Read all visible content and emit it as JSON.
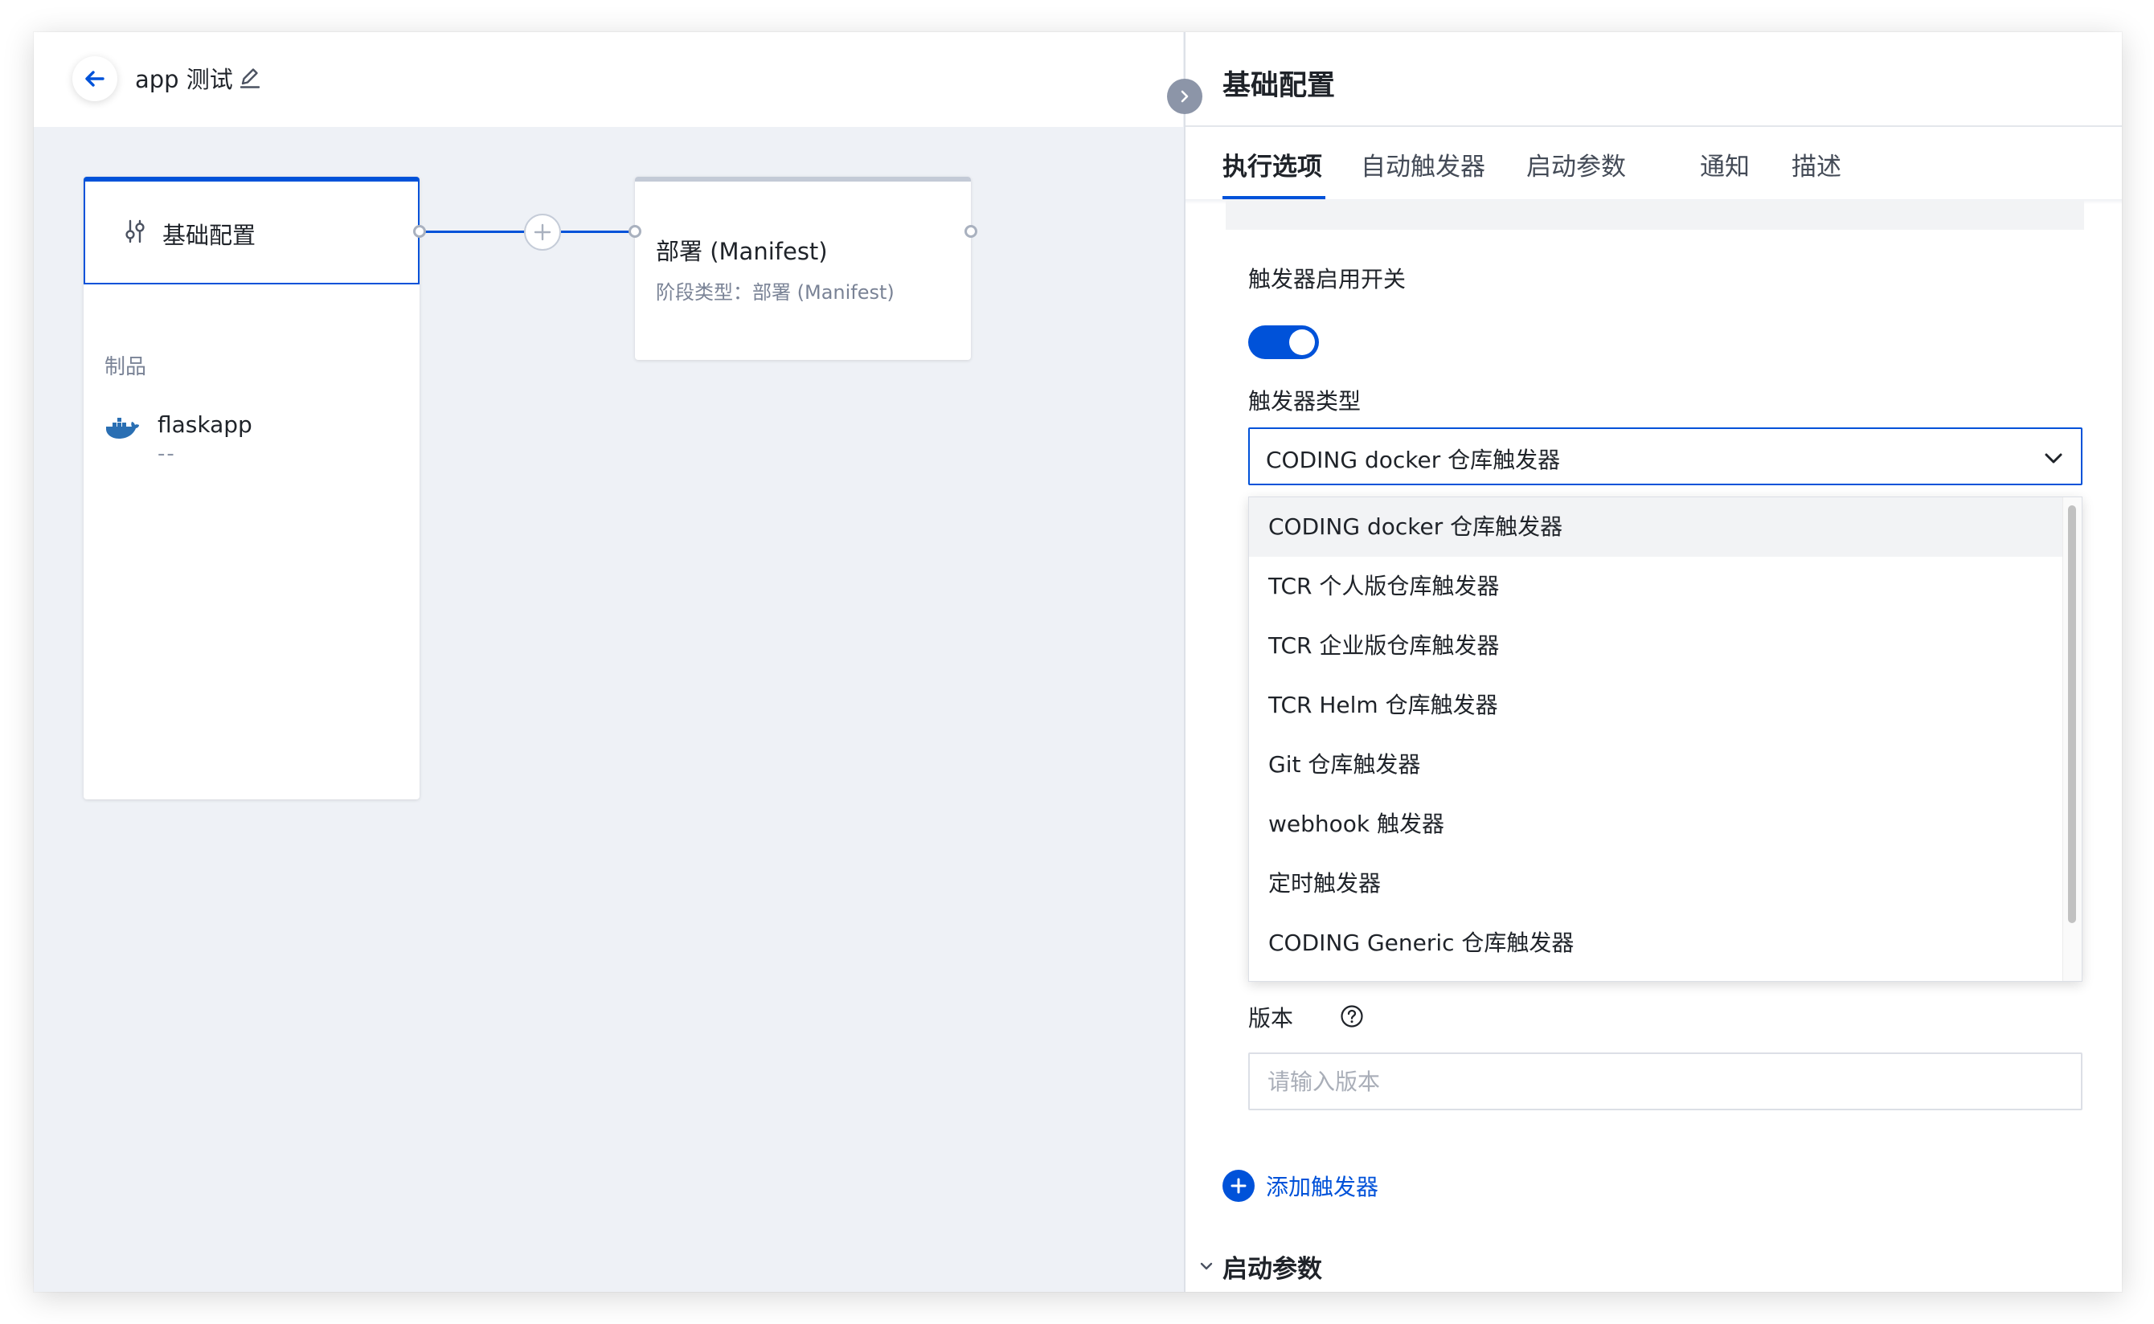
{
  "header": {
    "app_name": "app 测试"
  },
  "pipeline": {
    "base_stage": {
      "name": "基础配置",
      "section_label": "制品",
      "artifact_name": "flaskapp",
      "artifact_version": "--"
    },
    "deploy_stage": {
      "name": "部署 (Manifest)",
      "subtitle": "阶段类型：部署 (Manifest)"
    }
  },
  "panel": {
    "title": "基础配置",
    "tabs": [
      {
        "label": "执行选项"
      },
      {
        "label": "自动触发器"
      },
      {
        "label": "启动参数"
      },
      {
        "label": "通知"
      },
      {
        "label": "描述"
      }
    ],
    "trigger_switch_label": "触发器启用开关",
    "trigger_enabled": true,
    "trigger_type_label": "触发器类型",
    "trigger_type_value": "CODING docker 仓库触发器",
    "trigger_type_options": [
      "CODING docker 仓库触发器",
      "TCR 个人版仓库触发器",
      "TCR 企业版仓库触发器",
      "TCR Helm 仓库触发器",
      "Git 仓库触发器",
      "webhook 触发器",
      "定时触发器",
      "CODING Generic 仓库触发器"
    ],
    "version_label": "版本",
    "version_placeholder": "请输入版本",
    "add_trigger_label": "添加触发器",
    "startup_params_section": "启动参数"
  },
  "colors": {
    "primary": "#0052d9",
    "canvas_bg": "#eef1f6",
    "muted_text": "#7a8396"
  },
  "icons": [
    "back-arrow-icon",
    "edit-pencil-icon",
    "sliders-icon",
    "docker-whale-icon",
    "plus-icon",
    "chevron-right-icon",
    "chevron-down-icon",
    "help-circle-icon",
    "add-circle-icon"
  ]
}
